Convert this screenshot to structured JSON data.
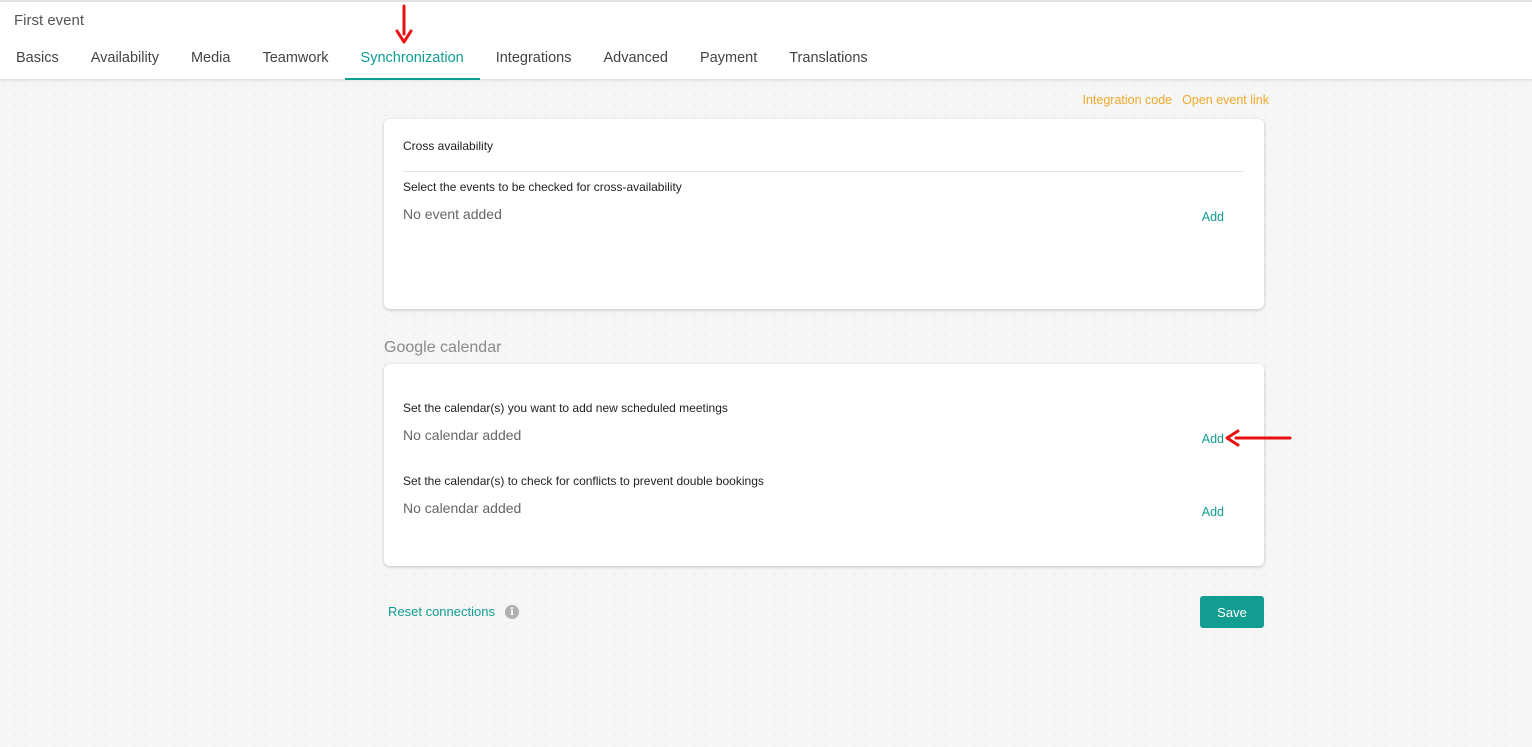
{
  "page": {
    "title": "First event"
  },
  "tabs": [
    {
      "label": "Basics"
    },
    {
      "label": "Availability"
    },
    {
      "label": "Media"
    },
    {
      "label": "Teamwork"
    },
    {
      "label": "Synchronization",
      "active": true
    },
    {
      "label": "Integrations"
    },
    {
      "label": "Advanced"
    },
    {
      "label": "Payment"
    },
    {
      "label": "Translations"
    }
  ],
  "top_links": {
    "integration_code": "Integration code",
    "open_event_link": "Open event link"
  },
  "cross_availability": {
    "title": "Cross availability",
    "label": "Select the events to be checked for cross-availability",
    "empty": "No event added",
    "add_label": "Add"
  },
  "google_calendar": {
    "section_title": "Google calendar",
    "new_meetings": {
      "label": "Set the calendar(s) you want to add new scheduled meetings",
      "empty": "No calendar added",
      "add_label": "Add"
    },
    "conflicts": {
      "label": "Set the calendar(s) to check for conflicts to prevent double bookings",
      "empty": "No calendar added",
      "add_label": "Add"
    }
  },
  "footer": {
    "reset_label": "Reset connections",
    "save_label": "Save"
  },
  "colors": {
    "accent": "#109d92",
    "link_orange": "#f0a92b",
    "annotation_red": "#e81010"
  },
  "icons": {
    "info": "info-icon",
    "annotation": "red-arrow-icon"
  }
}
